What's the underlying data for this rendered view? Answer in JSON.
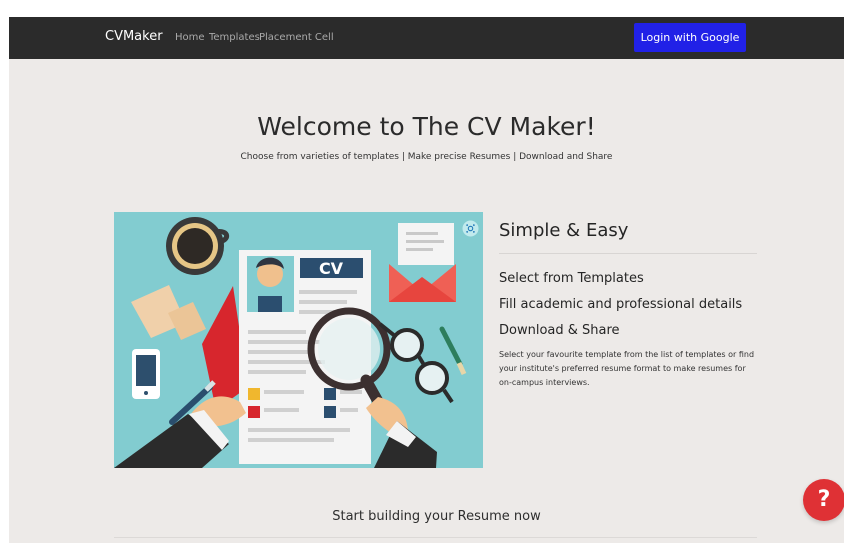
{
  "navbar": {
    "brand": "CVMaker",
    "links": [
      "Home",
      "Templates",
      "Placement Cell"
    ],
    "login_label": "Login with Google"
  },
  "hero": {
    "title": "Welcome to The CV Maker!",
    "subtitle": "Choose from varieties of templates | Make precise Resumes | Download and Share"
  },
  "illustration": {
    "cv_label": "CV",
    "corner_icon": "capture-icon"
  },
  "feature": {
    "title": "Simple & Easy",
    "items": [
      "Select from Templates",
      "Fill academic and professional details",
      "Download & Share"
    ],
    "description": "Select your favourite template from the list of templates or find your institute's preferred resume format to make resumes for on-campus interviews."
  },
  "cta": {
    "text": "Start building your Resume now"
  },
  "help": {
    "label": "?",
    "icon": "help-icon"
  },
  "colors": {
    "background": "#edeae8",
    "navbar": "#2b2b2b",
    "login_button": "#2121e7",
    "illustration_background": "#82ccd0",
    "help_button": "#df3135"
  }
}
